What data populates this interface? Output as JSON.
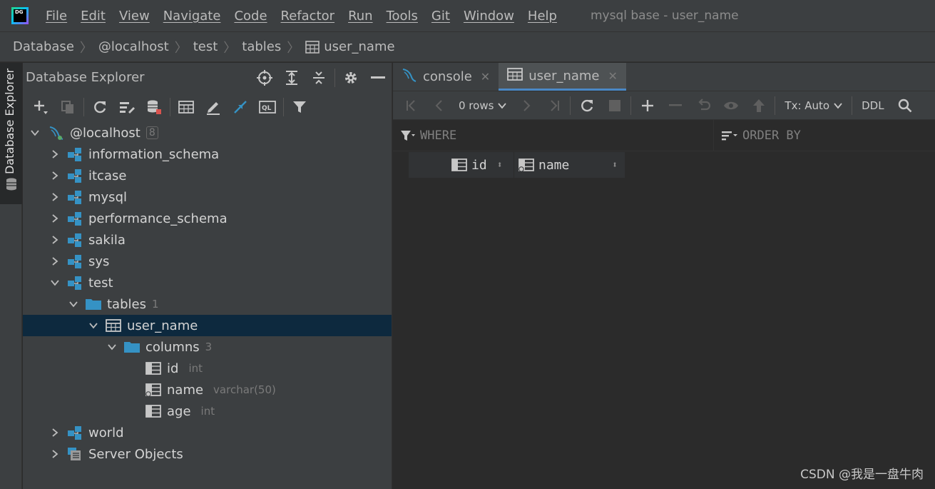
{
  "menubar": {
    "app_icon_text": "DG",
    "items": [
      "File",
      "Edit",
      "View",
      "Navigate",
      "Code",
      "Refactor",
      "Run",
      "Tools",
      "Git",
      "Window",
      "Help"
    ],
    "window_title": "mysql base - user_name"
  },
  "breadcrumb": [
    "Database",
    "@localhost",
    "test",
    "tables",
    "user_name"
  ],
  "toolstrip": {
    "label": "Database Explorer"
  },
  "explorer": {
    "title": "Database Explorer",
    "tree": {
      "root": {
        "label": "@localhost",
        "count": "8"
      },
      "schemas": [
        "information_schema",
        "itcase",
        "mysql",
        "performance_schema",
        "sakila",
        "sys"
      ],
      "test": {
        "label": "test"
      },
      "tables": {
        "label": "tables",
        "count": "1"
      },
      "user_name": {
        "label": "user_name"
      },
      "columns": {
        "label": "columns",
        "count": "3"
      },
      "columns_list": [
        {
          "name": "id",
          "type": "int"
        },
        {
          "name": "name",
          "type": "varchar(50)"
        },
        {
          "name": "age",
          "type": "int"
        }
      ],
      "world": {
        "label": "world"
      },
      "server_objects": {
        "label": "Server Objects"
      }
    }
  },
  "editor": {
    "tabs": [
      {
        "label": "console",
        "active": false
      },
      {
        "label": "user_name",
        "active": true
      }
    ],
    "toolbar": {
      "rows": "0 rows",
      "tx": "Tx: Auto",
      "ddl": "DDL"
    },
    "filter": {
      "where": "WHERE",
      "order_by": "ORDER BY"
    },
    "columns": [
      "id",
      "name"
    ]
  },
  "watermark": "CSDN @我是一盘牛肉",
  "colors": {
    "selection": "#0d293e",
    "accent": "#4a88c7",
    "schema_icon": "#3592c4"
  }
}
